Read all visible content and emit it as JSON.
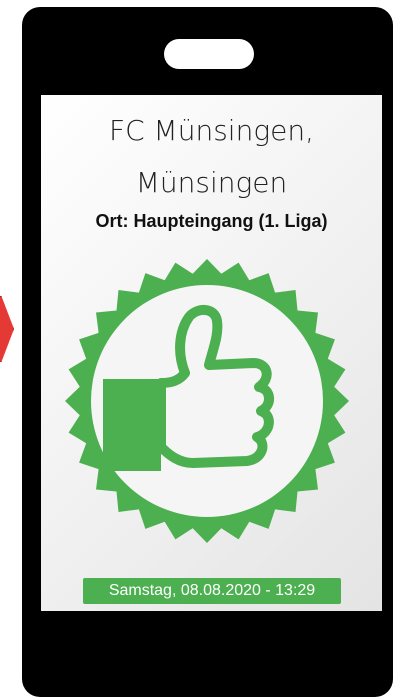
{
  "ticket": {
    "club_name": "FC Münsingen, Münsingen",
    "location": "Ort: Haupteingang (1. Liga)",
    "timestamp": "Samstag, 08.08.2020 - 13:29",
    "status_icon": "thumbs-up-icon",
    "accent_color": "#4caf50",
    "frame_color": "#000000"
  }
}
